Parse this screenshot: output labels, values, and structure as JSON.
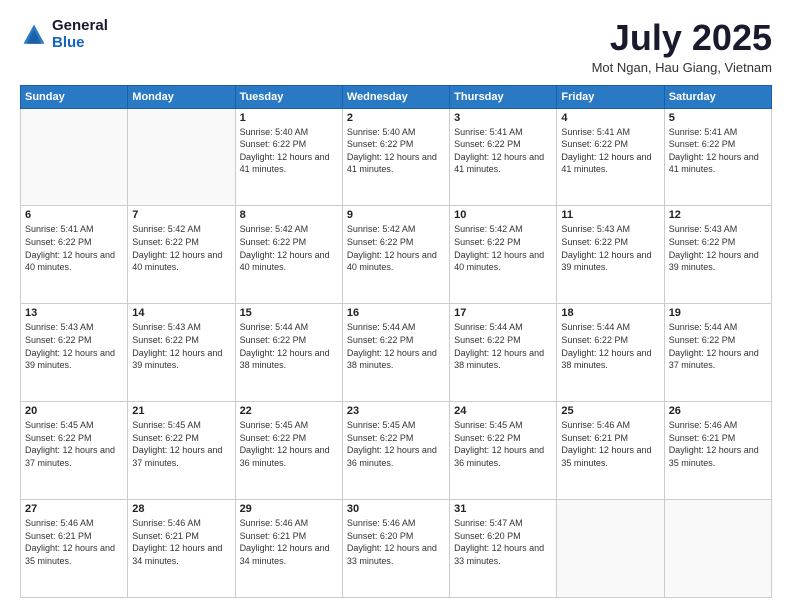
{
  "header": {
    "logo_general": "General",
    "logo_blue": "Blue",
    "month_title": "July 2025",
    "location": "Mot Ngan, Hau Giang, Vietnam"
  },
  "weekdays": [
    "Sunday",
    "Monday",
    "Tuesday",
    "Wednesday",
    "Thursday",
    "Friday",
    "Saturday"
  ],
  "weeks": [
    [
      {
        "day": "",
        "empty": true
      },
      {
        "day": "",
        "empty": true
      },
      {
        "day": "1",
        "sunrise": "Sunrise: 5:40 AM",
        "sunset": "Sunset: 6:22 PM",
        "daylight": "Daylight: 12 hours and 41 minutes."
      },
      {
        "day": "2",
        "sunrise": "Sunrise: 5:40 AM",
        "sunset": "Sunset: 6:22 PM",
        "daylight": "Daylight: 12 hours and 41 minutes."
      },
      {
        "day": "3",
        "sunrise": "Sunrise: 5:41 AM",
        "sunset": "Sunset: 6:22 PM",
        "daylight": "Daylight: 12 hours and 41 minutes."
      },
      {
        "day": "4",
        "sunrise": "Sunrise: 5:41 AM",
        "sunset": "Sunset: 6:22 PM",
        "daylight": "Daylight: 12 hours and 41 minutes."
      },
      {
        "day": "5",
        "sunrise": "Sunrise: 5:41 AM",
        "sunset": "Sunset: 6:22 PM",
        "daylight": "Daylight: 12 hours and 41 minutes."
      }
    ],
    [
      {
        "day": "6",
        "sunrise": "Sunrise: 5:41 AM",
        "sunset": "Sunset: 6:22 PM",
        "daylight": "Daylight: 12 hours and 40 minutes."
      },
      {
        "day": "7",
        "sunrise": "Sunrise: 5:42 AM",
        "sunset": "Sunset: 6:22 PM",
        "daylight": "Daylight: 12 hours and 40 minutes."
      },
      {
        "day": "8",
        "sunrise": "Sunrise: 5:42 AM",
        "sunset": "Sunset: 6:22 PM",
        "daylight": "Daylight: 12 hours and 40 minutes."
      },
      {
        "day": "9",
        "sunrise": "Sunrise: 5:42 AM",
        "sunset": "Sunset: 6:22 PM",
        "daylight": "Daylight: 12 hours and 40 minutes."
      },
      {
        "day": "10",
        "sunrise": "Sunrise: 5:42 AM",
        "sunset": "Sunset: 6:22 PM",
        "daylight": "Daylight: 12 hours and 40 minutes."
      },
      {
        "day": "11",
        "sunrise": "Sunrise: 5:43 AM",
        "sunset": "Sunset: 6:22 PM",
        "daylight": "Daylight: 12 hours and 39 minutes."
      },
      {
        "day": "12",
        "sunrise": "Sunrise: 5:43 AM",
        "sunset": "Sunset: 6:22 PM",
        "daylight": "Daylight: 12 hours and 39 minutes."
      }
    ],
    [
      {
        "day": "13",
        "sunrise": "Sunrise: 5:43 AM",
        "sunset": "Sunset: 6:22 PM",
        "daylight": "Daylight: 12 hours and 39 minutes."
      },
      {
        "day": "14",
        "sunrise": "Sunrise: 5:43 AM",
        "sunset": "Sunset: 6:22 PM",
        "daylight": "Daylight: 12 hours and 39 minutes."
      },
      {
        "day": "15",
        "sunrise": "Sunrise: 5:44 AM",
        "sunset": "Sunset: 6:22 PM",
        "daylight": "Daylight: 12 hours and 38 minutes."
      },
      {
        "day": "16",
        "sunrise": "Sunrise: 5:44 AM",
        "sunset": "Sunset: 6:22 PM",
        "daylight": "Daylight: 12 hours and 38 minutes."
      },
      {
        "day": "17",
        "sunrise": "Sunrise: 5:44 AM",
        "sunset": "Sunset: 6:22 PM",
        "daylight": "Daylight: 12 hours and 38 minutes."
      },
      {
        "day": "18",
        "sunrise": "Sunrise: 5:44 AM",
        "sunset": "Sunset: 6:22 PM",
        "daylight": "Daylight: 12 hours and 38 minutes."
      },
      {
        "day": "19",
        "sunrise": "Sunrise: 5:44 AM",
        "sunset": "Sunset: 6:22 PM",
        "daylight": "Daylight: 12 hours and 37 minutes."
      }
    ],
    [
      {
        "day": "20",
        "sunrise": "Sunrise: 5:45 AM",
        "sunset": "Sunset: 6:22 PM",
        "daylight": "Daylight: 12 hours and 37 minutes."
      },
      {
        "day": "21",
        "sunrise": "Sunrise: 5:45 AM",
        "sunset": "Sunset: 6:22 PM",
        "daylight": "Daylight: 12 hours and 37 minutes."
      },
      {
        "day": "22",
        "sunrise": "Sunrise: 5:45 AM",
        "sunset": "Sunset: 6:22 PM",
        "daylight": "Daylight: 12 hours and 36 minutes."
      },
      {
        "day": "23",
        "sunrise": "Sunrise: 5:45 AM",
        "sunset": "Sunset: 6:22 PM",
        "daylight": "Daylight: 12 hours and 36 minutes."
      },
      {
        "day": "24",
        "sunrise": "Sunrise: 5:45 AM",
        "sunset": "Sunset: 6:22 PM",
        "daylight": "Daylight: 12 hours and 36 minutes."
      },
      {
        "day": "25",
        "sunrise": "Sunrise: 5:46 AM",
        "sunset": "Sunset: 6:21 PM",
        "daylight": "Daylight: 12 hours and 35 minutes."
      },
      {
        "day": "26",
        "sunrise": "Sunrise: 5:46 AM",
        "sunset": "Sunset: 6:21 PM",
        "daylight": "Daylight: 12 hours and 35 minutes."
      }
    ],
    [
      {
        "day": "27",
        "sunrise": "Sunrise: 5:46 AM",
        "sunset": "Sunset: 6:21 PM",
        "daylight": "Daylight: 12 hours and 35 minutes."
      },
      {
        "day": "28",
        "sunrise": "Sunrise: 5:46 AM",
        "sunset": "Sunset: 6:21 PM",
        "daylight": "Daylight: 12 hours and 34 minutes."
      },
      {
        "day": "29",
        "sunrise": "Sunrise: 5:46 AM",
        "sunset": "Sunset: 6:21 PM",
        "daylight": "Daylight: 12 hours and 34 minutes."
      },
      {
        "day": "30",
        "sunrise": "Sunrise: 5:46 AM",
        "sunset": "Sunset: 6:20 PM",
        "daylight": "Daylight: 12 hours and 33 minutes."
      },
      {
        "day": "31",
        "sunrise": "Sunrise: 5:47 AM",
        "sunset": "Sunset: 6:20 PM",
        "daylight": "Daylight: 12 hours and 33 minutes."
      },
      {
        "day": "",
        "empty": true
      },
      {
        "day": "",
        "empty": true
      }
    ]
  ]
}
